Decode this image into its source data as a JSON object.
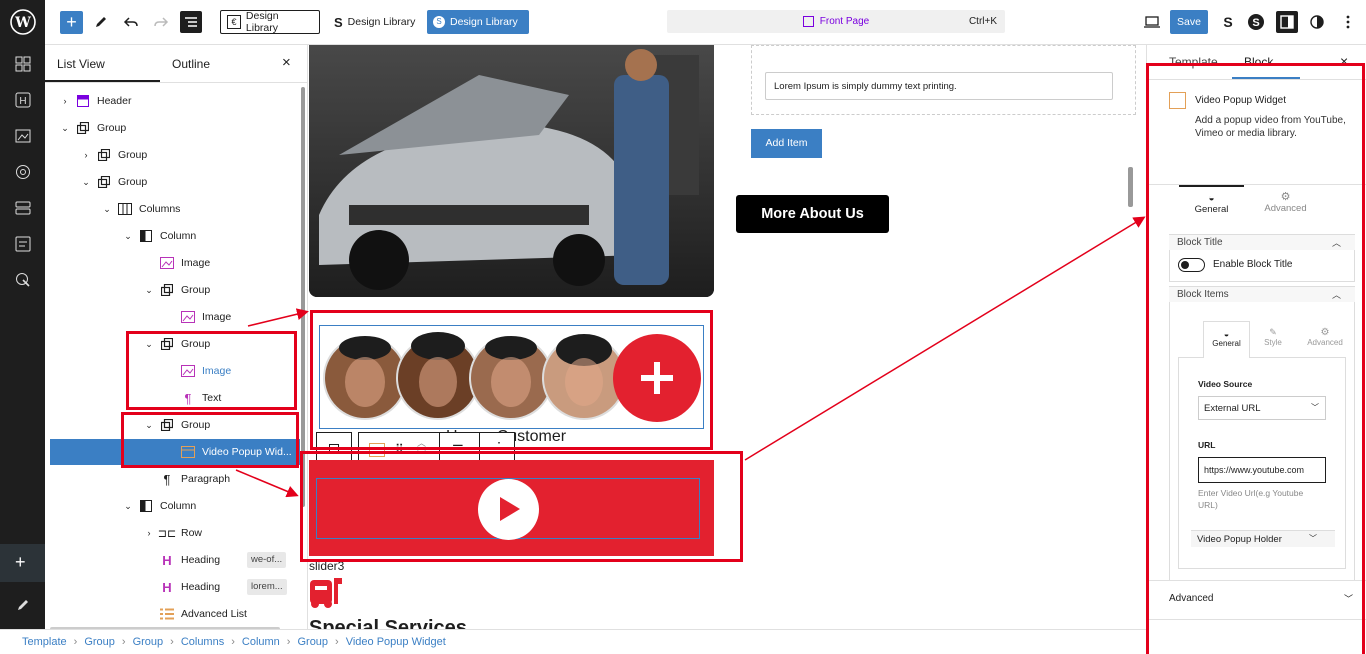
{
  "topbar": {
    "design_library_1": "Design Library",
    "design_library_2": "Design Library",
    "design_library_3": "Design Library",
    "command_label": "Front Page",
    "command_shortcut": "Ctrl+K",
    "save_label": "Save"
  },
  "listview": {
    "tab_list": "List View",
    "tab_outline": "Outline",
    "items": [
      {
        "label": "Header"
      },
      {
        "label": "Group"
      },
      {
        "label": "Group"
      },
      {
        "label": "Group"
      },
      {
        "label": "Columns"
      },
      {
        "label": "Column"
      },
      {
        "label": "Image"
      },
      {
        "label": "Group"
      },
      {
        "label": "Image"
      },
      {
        "label": "Group"
      },
      {
        "label": "Image"
      },
      {
        "label": "Text"
      },
      {
        "label": "Group"
      },
      {
        "label": "Video Popup Wid..."
      },
      {
        "label": "Paragraph"
      },
      {
        "label": "Column"
      },
      {
        "label": "Row"
      },
      {
        "label": "Heading",
        "badge": "we-of..."
      },
      {
        "label": "Heading",
        "badge": "lorem..."
      },
      {
        "label": "Advanced List"
      }
    ]
  },
  "breadcrumb": [
    "Template",
    "Group",
    "Group",
    "Columns",
    "Column",
    "Group",
    "Video Popup Widget"
  ],
  "canvas": {
    "list_item_text": "Lorem Ipsum is simply dummy text printing.",
    "add_item": "Add Item",
    "more_about": "More About Us",
    "customer_caption": "Happy Customer",
    "slider_label": "slider3",
    "special_services": "Special Services"
  },
  "sidebar": {
    "tab_template": "Template",
    "tab_block": "Block",
    "block_name": "Video Popup Widget",
    "block_desc": "Add a popup video from YouTube, Vimeo or media library.",
    "tab_general": "General",
    "tab_advanced": "Advanced",
    "block_title_section": "Block Title",
    "enable_title": "Enable Block Title",
    "block_items_section": "Block Items",
    "inner_general": "General",
    "inner_style": "Style",
    "inner_advanced": "Advanced",
    "video_source_label": "Video Source",
    "video_source_value": "External URL",
    "url_label": "URL",
    "url_value": "https://www.youtube.com",
    "url_help": "Enter Video Url(e.g Youtube URL)",
    "holder_label": "Video Popup Holder",
    "advanced_section": "Advanced"
  },
  "colors": {
    "accent": "#3b7fc4",
    "brand_red": "#e3212f",
    "highlight": "#e3001b"
  }
}
